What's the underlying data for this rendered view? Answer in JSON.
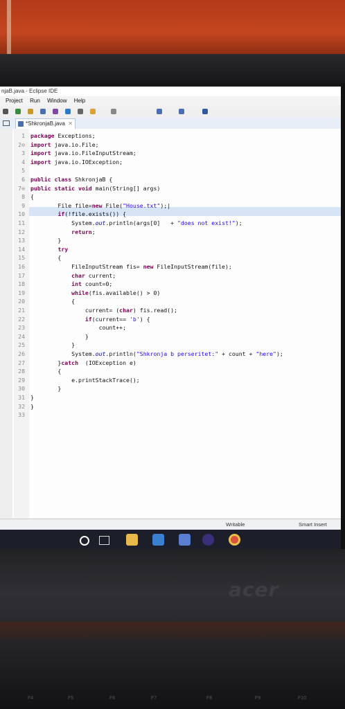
{
  "window": {
    "title": "njaB.java - Eclipse IDE"
  },
  "menu": [
    "Project",
    "Run",
    "Window",
    "Help"
  ],
  "editor_tab": {
    "label": "*ShkronjaB.java",
    "close": "✕"
  },
  "code_lines": [
    {
      "n": "1",
      "parts": [
        {
          "k": "kw",
          "t": "package"
        },
        {
          "t": " Exceptions;"
        }
      ]
    },
    {
      "n": "2",
      "parts": [
        {
          "k": "kw",
          "t": "import"
        },
        {
          "t": " java.io.File;"
        }
      ],
      "marker": "⊖"
    },
    {
      "n": "3",
      "parts": [
        {
          "k": "kw",
          "t": "import"
        },
        {
          "t": " java.io.FileInputStream;"
        }
      ]
    },
    {
      "n": "4",
      "parts": [
        {
          "k": "kw",
          "t": "import"
        },
        {
          "t": " java.io.IOException;"
        }
      ]
    },
    {
      "n": "5",
      "parts": []
    },
    {
      "n": "6",
      "parts": [
        {
          "k": "kw",
          "t": "public class"
        },
        {
          "t": " ShkronjaB {"
        }
      ]
    },
    {
      "n": "7",
      "parts": [
        {
          "k": "kw",
          "t": "public static void"
        },
        {
          "t": " main(String[] args)"
        }
      ],
      "marker": "⊖"
    },
    {
      "n": "8",
      "parts": [
        {
          "t": "{"
        }
      ]
    },
    {
      "n": "9",
      "parts": [
        {
          "t": "        File file="
        },
        {
          "k": "kw",
          "t": "new"
        },
        {
          "t": " File("
        },
        {
          "k": "str",
          "t": "\"House.txt\""
        },
        {
          "t": ");|"
        }
      ]
    },
    {
      "n": "10",
      "parts": [
        {
          "t": "        "
        },
        {
          "k": "kw",
          "t": "if"
        },
        {
          "t": "(!file.exists()) {"
        }
      ]
    },
    {
      "n": "11",
      "parts": [
        {
          "t": "            System."
        },
        {
          "k": "fld",
          "t": "out"
        },
        {
          "t": ".println(args[0]   + "
        },
        {
          "k": "str",
          "t": "\"does not exist!\""
        },
        {
          "t": ");"
        }
      ]
    },
    {
      "n": "12",
      "parts": [
        {
          "t": "            "
        },
        {
          "k": "kw",
          "t": "return"
        },
        {
          "t": ";"
        }
      ]
    },
    {
      "n": "13",
      "parts": [
        {
          "t": "        }"
        }
      ]
    },
    {
      "n": "14",
      "parts": [
        {
          "t": "        "
        },
        {
          "k": "kw",
          "t": "try"
        }
      ]
    },
    {
      "n": "15",
      "parts": [
        {
          "t": "        {"
        }
      ]
    },
    {
      "n": "16",
      "parts": [
        {
          "t": "            FileInputStream fis= "
        },
        {
          "k": "kw",
          "t": "new"
        },
        {
          "t": " FileInputStream(file);"
        }
      ]
    },
    {
      "n": "17",
      "parts": [
        {
          "t": "            "
        },
        {
          "k": "kw",
          "t": "char"
        },
        {
          "t": " current;"
        }
      ]
    },
    {
      "n": "18",
      "parts": [
        {
          "t": "            "
        },
        {
          "k": "kw",
          "t": "int"
        },
        {
          "t": " count=0;"
        }
      ]
    },
    {
      "n": "19",
      "parts": [
        {
          "t": "            "
        },
        {
          "k": "kw",
          "t": "while"
        },
        {
          "t": "(fis.available() > 0)"
        }
      ]
    },
    {
      "n": "20",
      "parts": [
        {
          "t": "            {"
        }
      ]
    },
    {
      "n": "21",
      "parts": [
        {
          "t": "                current= ("
        },
        {
          "k": "kw",
          "t": "char"
        },
        {
          "t": ") fis.read();"
        }
      ]
    },
    {
      "n": "22",
      "parts": [
        {
          "t": "                "
        },
        {
          "k": "kw",
          "t": "if"
        },
        {
          "t": "(current== "
        },
        {
          "k": "str",
          "t": "'b'"
        },
        {
          "t": ") {"
        }
      ]
    },
    {
      "n": "23",
      "parts": [
        {
          "t": "                    count++;"
        }
      ]
    },
    {
      "n": "24",
      "parts": [
        {
          "t": "                }"
        }
      ]
    },
    {
      "n": "25",
      "parts": [
        {
          "t": "            }"
        }
      ]
    },
    {
      "n": "26",
      "parts": [
        {
          "t": "            System."
        },
        {
          "k": "fld",
          "t": "out"
        },
        {
          "t": ".println("
        },
        {
          "k": "str",
          "t": "\"Shkronja b perseritet:\""
        },
        {
          "t": " + count + "
        },
        {
          "k": "str",
          "t": "\"here\""
        },
        {
          "t": ");"
        }
      ]
    },
    {
      "n": "27",
      "parts": [
        {
          "t": "        }"
        },
        {
          "k": "kw",
          "t": "catch"
        },
        {
          "t": "  (IOException e)"
        }
      ]
    },
    {
      "n": "28",
      "parts": [
        {
          "t": "        {"
        }
      ]
    },
    {
      "n": "29",
      "parts": [
        {
          "t": "            e.printStackTrace();"
        }
      ]
    },
    {
      "n": "30",
      "parts": [
        {
          "t": "        }"
        }
      ]
    },
    {
      "n": "31",
      "parts": [
        {
          "t": "}"
        }
      ]
    },
    {
      "n": "32",
      "parts": [
        {
          "t": "}"
        }
      ]
    },
    {
      "n": "33",
      "parts": []
    }
  ],
  "status": {
    "writable": "Writable",
    "insert_mode": "Smart Insert"
  },
  "laptop": {
    "brand": "acer",
    "fkeys": [
      "F4",
      "F5",
      "F6",
      "F7",
      "F8",
      "F9",
      "F10"
    ]
  },
  "colors": {
    "keyword": "#7f0055",
    "string": "#2a00ff",
    "field": "#0000c0",
    "current_line": "#d6e4f5"
  }
}
